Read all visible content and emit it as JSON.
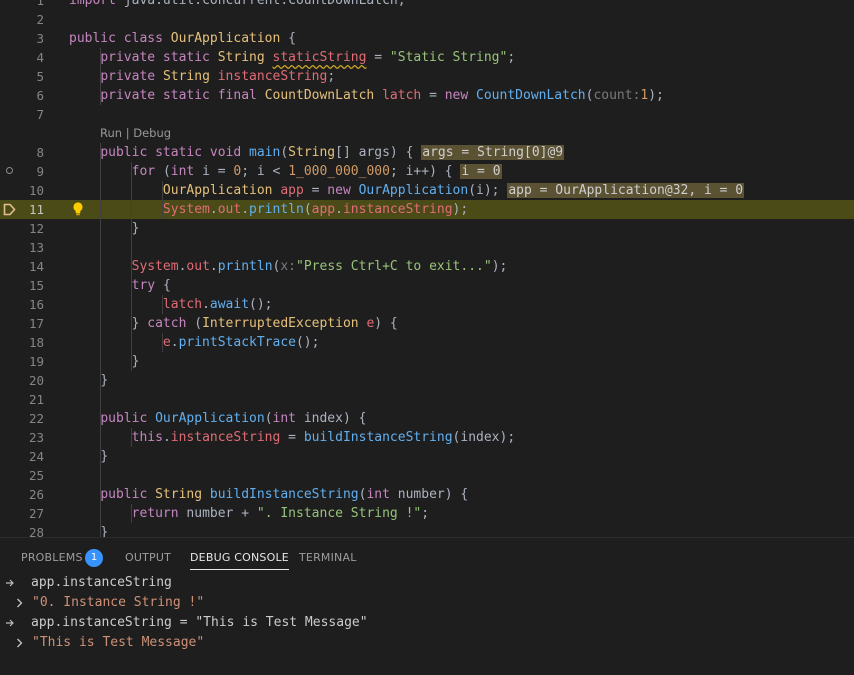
{
  "editor": {
    "lines": [
      {
        "n": "1",
        "html": "<span class=\"k\">import</span> <span class=\"p\">java.util.concurrent.CountDownLatch;</span>"
      },
      {
        "n": "2",
        "html": ""
      },
      {
        "n": "3",
        "html": "<span class=\"k\">public class</span> <span class=\"ty\">OurApplication</span> <span class=\"p\">{</span>"
      },
      {
        "n": "4",
        "html": "    <span class=\"k\">private static</span> <span class=\"ty\">String</span> <span class=\"v sq\">staticString</span> <span class=\"p\">=</span> <span class=\"s\">\"Static String\"</span><span class=\"p\">;</span>"
      },
      {
        "n": "5",
        "html": "    <span class=\"k\">private</span> <span class=\"ty\">String</span> <span class=\"v\">instanceString</span><span class=\"p\">;</span>"
      },
      {
        "n": "6",
        "html": "    <span class=\"k\">private static final</span> <span class=\"ty\">CountDownLatch</span> <span class=\"v\">latch</span> <span class=\"p\">=</span> <span class=\"k\">new</span> <span class=\"f\">CountDownLatch</span><span class=\"p\">(</span><span class=\"hint\">count:</span><span class=\"n\">1</span><span class=\"p\">);</span>"
      },
      {
        "n": "7",
        "html": ""
      },
      {
        "n": "8",
        "html": "    <span class=\"k\">public static void</span> <span class=\"f\">main</span><span class=\"p\">(</span><span class=\"ty\">String</span><span class=\"p\">[] args) {</span> <span class=\"inl\">args = String[0]@9</span>"
      },
      {
        "n": "9",
        "html": "        <span class=\"k\">for</span> <span class=\"p\">(</span><span class=\"k\">int</span> <span class=\"p\">i =</span> <span class=\"n\">0</span><span class=\"p\">; i &lt;</span> <span class=\"n\">1_000_000_000</span><span class=\"p\">; i++) {</span> <span class=\"inl\">i = 0</span>"
      },
      {
        "n": "10",
        "html": "            <span class=\"ty\">OurApplication</span> <span class=\"v\">app</span> <span class=\"p\">=</span> <span class=\"k\">new</span> <span class=\"f\">OurApplication</span><span class=\"p\">(i);</span> <span class=\"inl\">app = OurApplication@32, i = 0</span>"
      },
      {
        "n": "11",
        "html": "            <span class=\"v\">System</span><span class=\"p\">.</span><span class=\"v\">out</span><span class=\"p\">.</span><span class=\"f\">println</span><span class=\"p\">(</span><span class=\"v\">app</span><span class=\"p\">.</span><span class=\"v\">instanceString</span><span class=\"p\">);</span>"
      },
      {
        "n": "12",
        "html": "        <span class=\"p\">}</span>"
      },
      {
        "n": "13",
        "html": ""
      },
      {
        "n": "14",
        "html": "        <span class=\"v\">System</span><span class=\"p\">.</span><span class=\"v\">out</span><span class=\"p\">.</span><span class=\"f\">println</span><span class=\"p\">(</span><span class=\"hint\">x:</span><span class=\"s\">\"Press Ctrl+C to exit...\"</span><span class=\"p\">);</span>"
      },
      {
        "n": "15",
        "html": "        <span class=\"k\">try</span> <span class=\"p\">{</span>"
      },
      {
        "n": "16",
        "html": "            <span class=\"v\">latch</span><span class=\"p\">.</span><span class=\"f\">await</span><span class=\"p\">();</span>"
      },
      {
        "n": "17",
        "html": "        <span class=\"p\">}</span> <span class=\"k\">catch</span> <span class=\"p\">(</span><span class=\"ty\">InterruptedException</span> <span class=\"v\">e</span><span class=\"p\">) {</span>"
      },
      {
        "n": "18",
        "html": "            <span class=\"v\">e</span><span class=\"p\">.</span><span class=\"f\">printStackTrace</span><span class=\"p\">();</span>"
      },
      {
        "n": "19",
        "html": "        <span class=\"p\">}</span>"
      },
      {
        "n": "20",
        "html": "    <span class=\"p\">}</span>"
      },
      {
        "n": "21",
        "html": ""
      },
      {
        "n": "22",
        "html": "    <span class=\"k\">public</span> <span class=\"f\">OurApplication</span><span class=\"p\">(</span><span class=\"k\">int</span> <span class=\"p\">index) {</span>"
      },
      {
        "n": "23",
        "html": "        <span class=\"k\">this</span><span class=\"p\">.</span><span class=\"v\">instanceString</span> <span class=\"p\">=</span> <span class=\"f\">buildInstanceString</span><span class=\"p\">(index);</span>"
      },
      {
        "n": "24",
        "html": "    <span class=\"p\">}</span>"
      },
      {
        "n": "25",
        "html": ""
      },
      {
        "n": "26",
        "html": "    <span class=\"k\">public</span> <span class=\"ty\">String</span> <span class=\"f\">buildInstanceString</span><span class=\"p\">(</span><span class=\"k\">int</span> <span class=\"p\">number) {</span>"
      },
      {
        "n": "27",
        "html": "        <span class=\"k\">return</span> <span class=\"p\">number +</span> <span class=\"s\">\". Instance String !\"</span><span class=\"p\">;</span>"
      },
      {
        "n": "28",
        "html": "    <span class=\"p\">}</span>"
      }
    ],
    "codelens": "Run | Debug",
    "current_line": "11",
    "breakpoint_line": "9",
    "colors": {
      "highlight": "#4b4b18",
      "accent": "#3794ff"
    }
  },
  "panel": {
    "tabs": [
      {
        "label": "PROBLEMS",
        "badge": "1"
      },
      {
        "label": "OUTPUT"
      },
      {
        "label": "DEBUG CONSOLE",
        "active": true
      },
      {
        "label": "TERMINAL"
      }
    ],
    "console": [
      {
        "icon": "input-arrow-icon",
        "text": "app.instanceString",
        "kind": "input"
      },
      {
        "icon": "chevron-right-icon",
        "text": "\"0. Instance String !\"",
        "kind": "result"
      },
      {
        "icon": "input-arrow-icon",
        "text": "app.instanceString = \"This is Test Message\"",
        "kind": "input"
      },
      {
        "icon": "chevron-right-icon",
        "text": "\"This is Test Message\"",
        "kind": "result"
      }
    ]
  }
}
